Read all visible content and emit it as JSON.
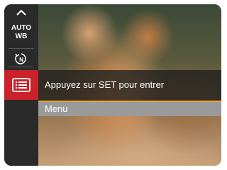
{
  "sidebar": {
    "up_icon": "chevron-up-icon",
    "awb_line1": "AUTO",
    "awb_line2": "WB",
    "reset_icon": "reset-n-icon",
    "menu_icon": "list-menu-icon"
  },
  "panel": {
    "prompt": "Appuyez sur SET pour entrer",
    "menu_label": "Menu"
  },
  "colors": {
    "accent": "#e8a629",
    "selected": "#c8222a"
  }
}
